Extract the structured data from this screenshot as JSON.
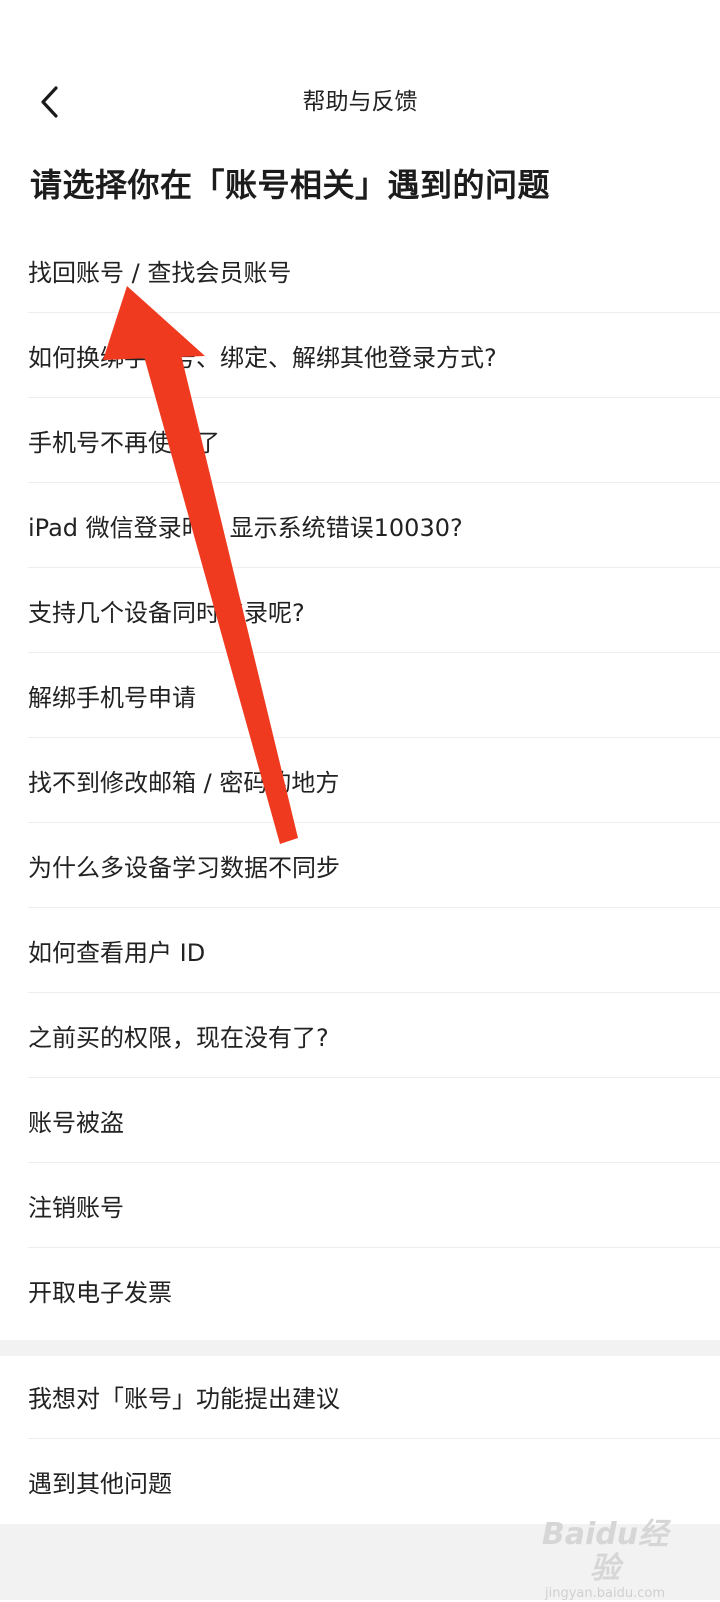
{
  "header": {
    "title": "帮助与反馈"
  },
  "page": {
    "heading": "请选择你在「账号相关」遇到的问题"
  },
  "questions": [
    "找回账号 / 查找会员账号",
    "如何换绑手机号、绑定、解绑其他登录方式?",
    "手机号不再使用了",
    "iPad 微信登录时，显示系统错误10030?",
    "支持几个设备同时登录呢?",
    "解绑手机号申请",
    "找不到修改邮箱 / 密码的地方",
    "为什么多设备学习数据不同步",
    "如何查看用户 ID",
    "之前买的权限，现在没有了?",
    "账号被盗",
    "注销账号",
    "开取电子发票"
  ],
  "feedback": [
    "我想对「账号」功能提出建议",
    "遇到其他问题"
  ],
  "annotation": {
    "arrow_color": "#f03a1f"
  },
  "watermark": {
    "logo": "Baidu经验",
    "url": "jingyan.baidu.com"
  }
}
